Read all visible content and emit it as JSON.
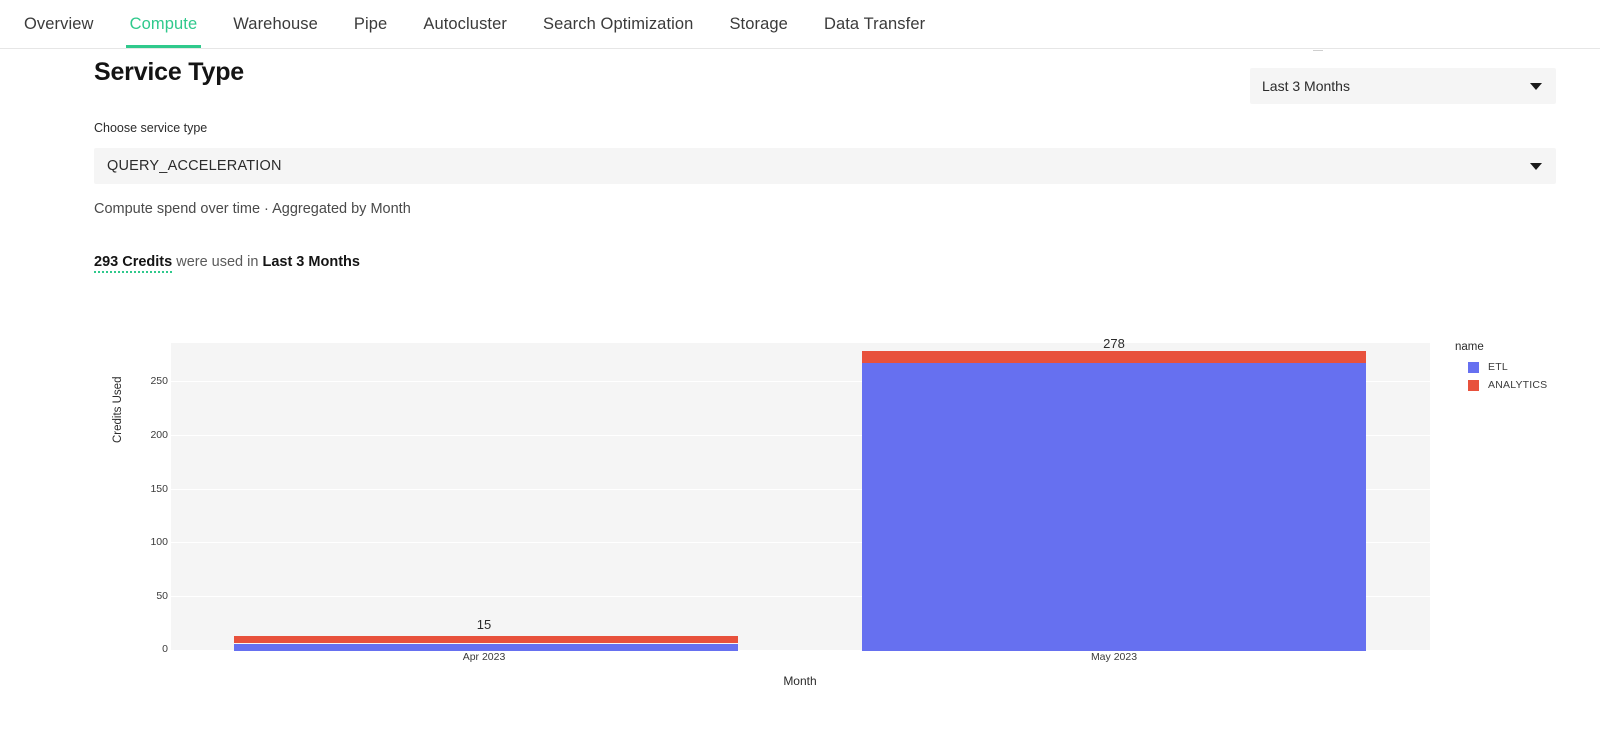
{
  "nav": {
    "items": [
      {
        "label": "Overview",
        "active": false
      },
      {
        "label": "Compute",
        "active": true
      },
      {
        "label": "Warehouse",
        "active": false
      },
      {
        "label": "Pipe",
        "active": false
      },
      {
        "label": "Autocluster",
        "active": false
      },
      {
        "label": "Search Optimization",
        "active": false
      },
      {
        "label": "Storage",
        "active": false
      },
      {
        "label": "Data Transfer",
        "active": false
      }
    ]
  },
  "header": {
    "title": "Service Type",
    "range_value": "Last 3 Months"
  },
  "service_picker": {
    "label": "Choose service type",
    "value": "QUERY_ACCELERATION"
  },
  "description": {
    "subtitle": "Compute spend over time · Aggregated by Month",
    "credits": "293 Credits",
    "middle": " were used in ",
    "range": "Last 3 Months"
  },
  "legend": {
    "title": "name",
    "entries": [
      {
        "label": "ETL",
        "color": "#6670f0"
      },
      {
        "label": "ANALYTICS",
        "color": "#e8513c"
      }
    ]
  },
  "chart_data": {
    "type": "bar",
    "stacked": true,
    "title": "",
    "xlabel": "Month",
    "ylabel": "Credits Used",
    "categories": [
      "Apr 2023",
      "May 2023"
    ],
    "series": [
      {
        "name": "ETL",
        "color": "#6670f0",
        "values": [
          9,
          255
        ]
      },
      {
        "name": "ANALYTICS",
        "color": "#e8513c",
        "values": [
          6,
          23
        ]
      }
    ],
    "totals": [
      15,
      278
    ],
    "yticks": [
      0,
      50,
      100,
      150,
      200,
      250
    ],
    "ylim": [
      0,
      295
    ],
    "grid": true,
    "legend_position": "right"
  }
}
